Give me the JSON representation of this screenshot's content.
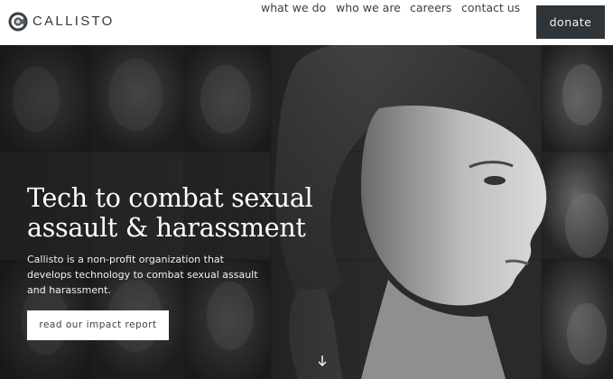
{
  "brand": {
    "name": "CALLISTO",
    "logo_icon": "callisto-c-logo-icon"
  },
  "nav": {
    "items": [
      {
        "label": "what we do"
      },
      {
        "label": "who we are"
      },
      {
        "label": "careers"
      },
      {
        "label": "contact us"
      }
    ],
    "donate_label": "donate"
  },
  "hero": {
    "headline_line1": "Tech to combat sexual",
    "headline_line2": "assault & harassment",
    "description": "Callisto is a non-profit organization that develops technology to combat sexual assault and harassment.",
    "cta_label": "read our impact report",
    "scroll_icon": "arrow-down-icon",
    "background": "grayscale-portrait-mosaic-photo"
  },
  "colors": {
    "header_bg": "#ffffff",
    "nav_text": "#3a3f46",
    "donate_bg": "#2f3439",
    "donate_text": "#f2f2f2",
    "hero_bg": "#262727",
    "hero_text": "#ffffff",
    "cta_bg": "#ffffff",
    "cta_text": "#3a3f46"
  }
}
